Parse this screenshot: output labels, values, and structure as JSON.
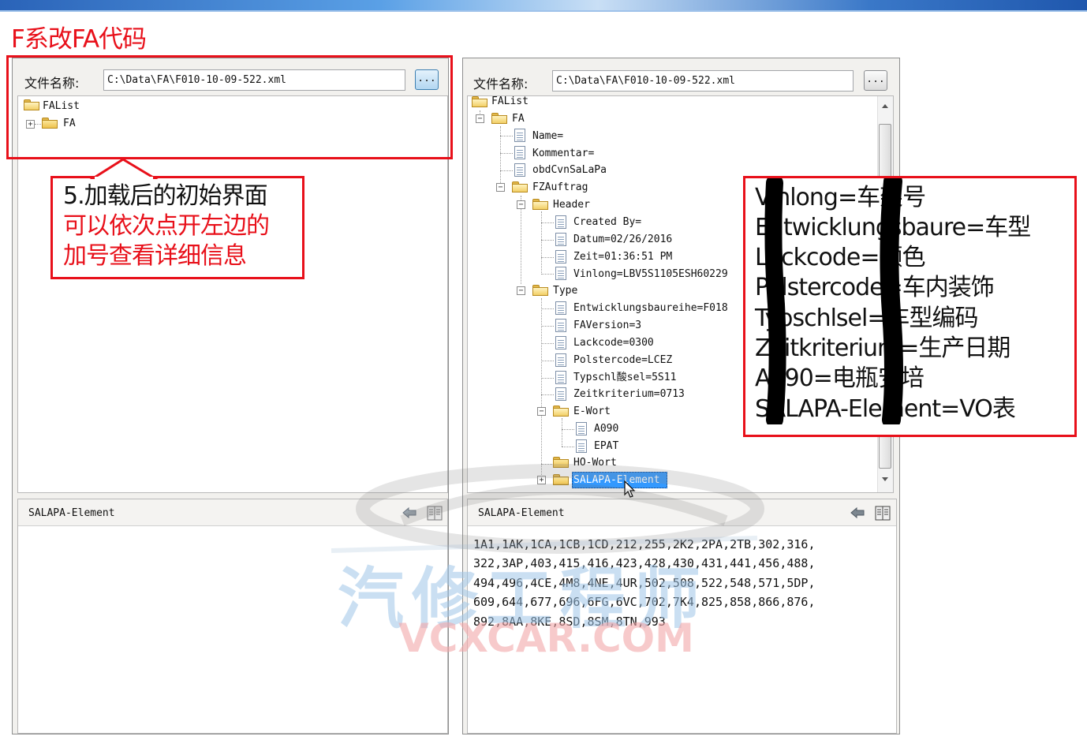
{
  "slide": {
    "title": "F系改FA代码"
  },
  "left_panel": {
    "file_label": "文件名称:",
    "file_value": "C:\\Data\\FA\\F010-10-09-522.xml",
    "browse_label": "...",
    "tree": {
      "root": "FAList",
      "child": "FA"
    },
    "bottom_title": "SALAPA-Element"
  },
  "right_panel": {
    "file_label": "文件名称:",
    "file_value": "C:\\Data\\FA\\F010-10-09-522.xml",
    "browse_label": "...",
    "tree": {
      "root": "FAList",
      "fa": "FA",
      "name": "Name=",
      "kommentar": "Kommentar=",
      "obd": "obdCvnSaLaPa",
      "fzauftrag": "FZAuftrag",
      "header": "Header",
      "created": "Created By=",
      "datum": "Datum=02/26/2016",
      "zeit": "Zeit=01:36:51 PM",
      "vinlong": "Vinlong=LBV5S1105ESH60229",
      "type": "Type",
      "entwicklung": "Entwicklungsbaureihe=F018",
      "faversion": "FAVersion=3",
      "lackcode": "Lackcode=0300",
      "polstercode": "Polstercode=LCEZ",
      "typschl": "Typschl酸sel=5S11",
      "zeitkriterium": "Zeitkriterium=0713",
      "ewort": "E-Wort",
      "a090": "A090",
      "epat": "EPAT",
      "howort": "HO-Wort",
      "salapa": "SALAPA-Element"
    },
    "bottom_title": "SALAPA-Element",
    "bottom_lines": [
      "1A1,1AK,1CA,1CB,1CD,212,255,2K2,2PA,2TB,302,316,",
      "322,3AP,403,415,416,423,428,430,431,441,456,488,",
      "494,496,4CE,4M8,4NE,4UR,502,508,522,548,571,5DP,",
      "609,644,677,696,6FG,6VC,702,7K4,825,858,866,876,",
      "892,8AA,8KE,8SD,8SM,8TN,993"
    ]
  },
  "callout_left": {
    "line1": "5.加载后的初始界面",
    "line2": "可以依次点开左边的",
    "line3": "加号查看详细信息",
    "color_black": "#111111",
    "color_red": "#e8101a"
  },
  "callout_right": {
    "lines": [
      "Vinlong=车架号",
      "Entwicklungsbaure=车型",
      "Lackcode=颜色",
      "Polstercode=车内装饰",
      "Typschlsel=车型编码",
      "Zeitkriterium=生产日期",
      "A090=电瓶安培",
      "SALAPA-Element=VO表"
    ]
  },
  "watermark": {
    "cn": "汽修工程师",
    "en": "VCXCAR.COM"
  },
  "colors": {
    "accent_red": "#e8101a",
    "selection": "#3399ff"
  }
}
